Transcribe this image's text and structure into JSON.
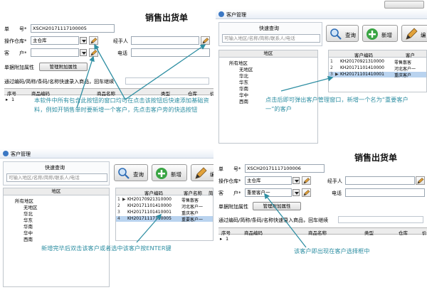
{
  "top_strip": {},
  "form_top": {
    "title": "销售出货单",
    "doc_no_label": "单　　号*",
    "doc_no_value": "XSCH20171117100005",
    "warehouse_label": "操作仓库*",
    "warehouse_value": "主仓库",
    "handler_label": "经手人",
    "customer_label": "客　　户*",
    "customer_value": "",
    "phone_label": "电话",
    "extra_label": "单据附加属性",
    "extra_button": "管理附加属性",
    "scan_hint": "通过编码/简称/条码/名称快速录入商品，回车继续",
    "columns": [
      "序号",
      "商品编码",
      "商品名称",
      "类型",
      "仓库",
      "价"
    ],
    "row_index": "1"
  },
  "dialog_top": {
    "title": "客户管理",
    "quick_query_label": "快速查询",
    "query_placeholder": "可输入地区/名称/简称/联系人/电话",
    "query_button": "查询",
    "add_button": "新增",
    "edit_button": "编",
    "area_header": "地区",
    "areas": [
      "所有地区",
      "无地区",
      "华北",
      "华东",
      "华南",
      "华中",
      "西南"
    ],
    "grid_headers": [
      "客户编码",
      "客户"
    ],
    "rows": [
      {
        "index": "1",
        "arrow": "",
        "code": "KH20170921310000",
        "name": "零售散客"
      },
      {
        "index": "2",
        "arrow": "",
        "code": "KH20171101410000",
        "name": "河北客户一"
      },
      {
        "index": "3",
        "arrow": "▶",
        "code": "KH20171101410001",
        "name": "重庆客户"
      }
    ]
  },
  "dialog_bottom": {
    "title": "客户管理",
    "quick_query_label": "快速查询",
    "query_placeholder": "可输入地区/名称/简称/联系人/电话",
    "query_button": "查询",
    "add_button": "新增",
    "edit_button": "编",
    "area_header": "地区",
    "areas": [
      "所有地区",
      "无地区",
      "华北",
      "华东",
      "华南",
      "华中",
      "西南"
    ],
    "grid_headers": [
      "客户编码",
      "客户名称",
      "简"
    ],
    "rows": [
      {
        "index": "1",
        "arrow": "▶",
        "code": "KH20170921310000",
        "name": "零售散客"
      },
      {
        "index": "2",
        "arrow": "",
        "code": "KH20171101410000",
        "name": "河北客户一"
      },
      {
        "index": "3",
        "arrow": "",
        "code": "KH20171101410001",
        "name": "重庆客户"
      },
      {
        "index": "4",
        "arrow": "",
        "code": "KH20171117110005",
        "name": "重要客户一"
      }
    ]
  },
  "form_bottom": {
    "title": "销售出货单",
    "doc_no_label": "单　　号*",
    "doc_no_value": "XSCH20171117100006",
    "warehouse_label": "操作仓库*",
    "warehouse_value": "主仓库",
    "handler_label": "经手人",
    "customer_label": "客　　户*",
    "customer_value": "重要客户一",
    "phone_label": "电话",
    "extra_label": "单据附加属性",
    "extra_button": "管理附加属性",
    "scan_hint": "通过编码/简称/条码/名称快速录入商品，回车继续",
    "columns": [
      "序号",
      "商品编码",
      "商品名称",
      "类型",
      "仓库",
      "价"
    ],
    "row_index": "1"
  },
  "annotations": {
    "note1": "本软件中所有包含此按钮的窗口均可在点击该按钮后快速添加基础资料，例如开销售单时要新增一个客户，先点击客户旁的快选按钮",
    "note2": "点击后即可弹出客户管理窗口，新增一个名为“重要客户一”的客户",
    "note3": "新增完毕后双击该客户或者选中该客户按ENTER键",
    "note4": "该客户即出现在客户选择框中"
  },
  "colors": {
    "annotation": "#2f8fa3",
    "selection": "#b9d3ef"
  }
}
